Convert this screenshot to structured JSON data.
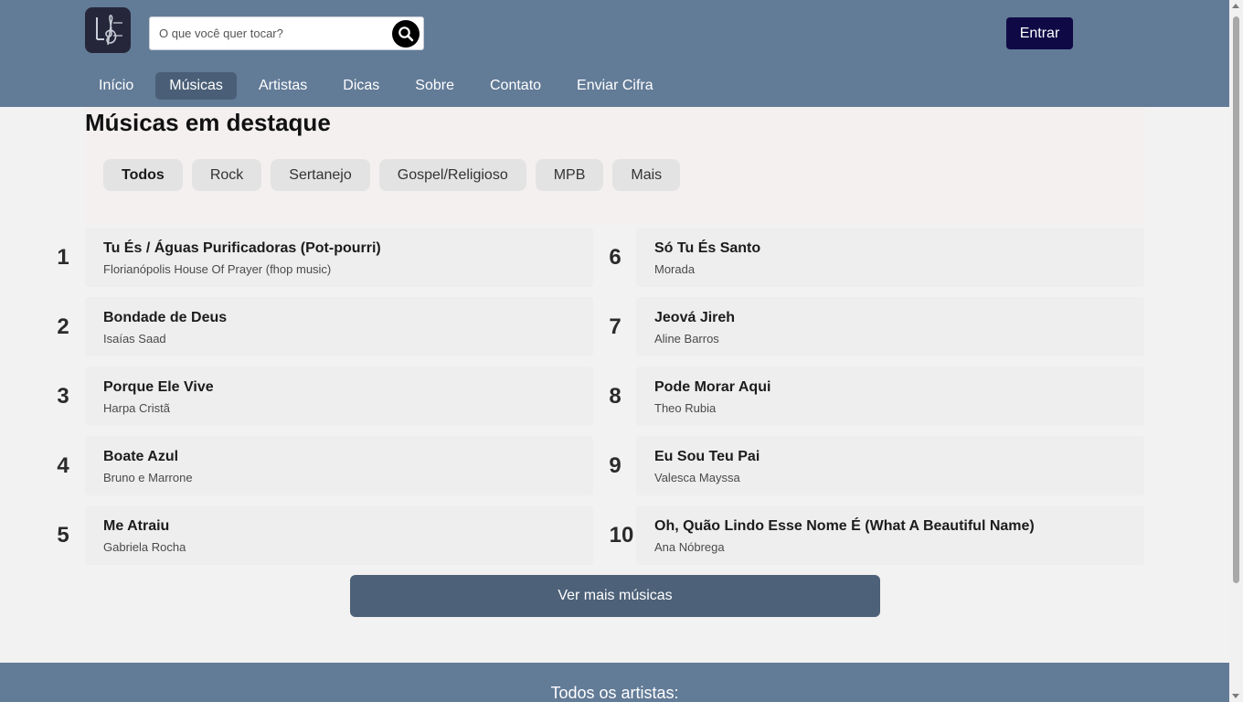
{
  "header": {
    "search_placeholder": "O que você quer tocar?",
    "login_label": "Entrar",
    "nav": [
      {
        "label": "Início",
        "active": false
      },
      {
        "label": "Músicas",
        "active": true
      },
      {
        "label": "Artistas",
        "active": false
      },
      {
        "label": "Dicas",
        "active": false
      },
      {
        "label": "Sobre",
        "active": false
      },
      {
        "label": "Contato",
        "active": false
      },
      {
        "label": "Enviar Cifra",
        "active": false
      }
    ]
  },
  "main": {
    "title": "Músicas em destaque",
    "filters": [
      {
        "label": "Todos",
        "active": true
      },
      {
        "label": "Rock",
        "active": false
      },
      {
        "label": "Sertanejo",
        "active": false
      },
      {
        "label": "Gospel/Religioso",
        "active": false
      },
      {
        "label": "MPB",
        "active": false
      },
      {
        "label": "Mais",
        "active": false
      }
    ],
    "songs": [
      {
        "rank": "1",
        "title": "Tu És / Águas Purificadoras (Pot-pourri)",
        "artist": "Florianópolis House Of Prayer (fhop music)"
      },
      {
        "rank": "2",
        "title": "Bondade de Deus",
        "artist": "Isaías Saad"
      },
      {
        "rank": "3",
        "title": "Porque Ele Vive",
        "artist": "Harpa Cristã"
      },
      {
        "rank": "4",
        "title": "Boate Azul",
        "artist": "Bruno e Marrone"
      },
      {
        "rank": "5",
        "title": "Me Atraiu",
        "artist": "Gabriela Rocha"
      },
      {
        "rank": "6",
        "title": "Só Tu És Santo",
        "artist": "Morada"
      },
      {
        "rank": "7",
        "title": "Jeová Jireh",
        "artist": "Aline Barros"
      },
      {
        "rank": "8",
        "title": "Pode Morar Aqui",
        "artist": "Theo Rubia"
      },
      {
        "rank": "9",
        "title": "Eu Sou Teu Pai",
        "artist": "Valesca Mayssa"
      },
      {
        "rank": "10",
        "title": "Oh, Quão Lindo Esse Nome É (What A Beautiful Name)",
        "artist": "Ana Nóbrega"
      }
    ],
    "more_label": "Ver mais músicas"
  },
  "footer": {
    "title": "Todos os artistas:"
  },
  "colors": {
    "header_bg": "#627b97",
    "nav_active": "#4a5f77",
    "login_bg": "#0f0a45",
    "more_button": "#4d6178"
  },
  "icons": {
    "logo": "treble-clef-logo-icon",
    "search": "search-icon"
  }
}
